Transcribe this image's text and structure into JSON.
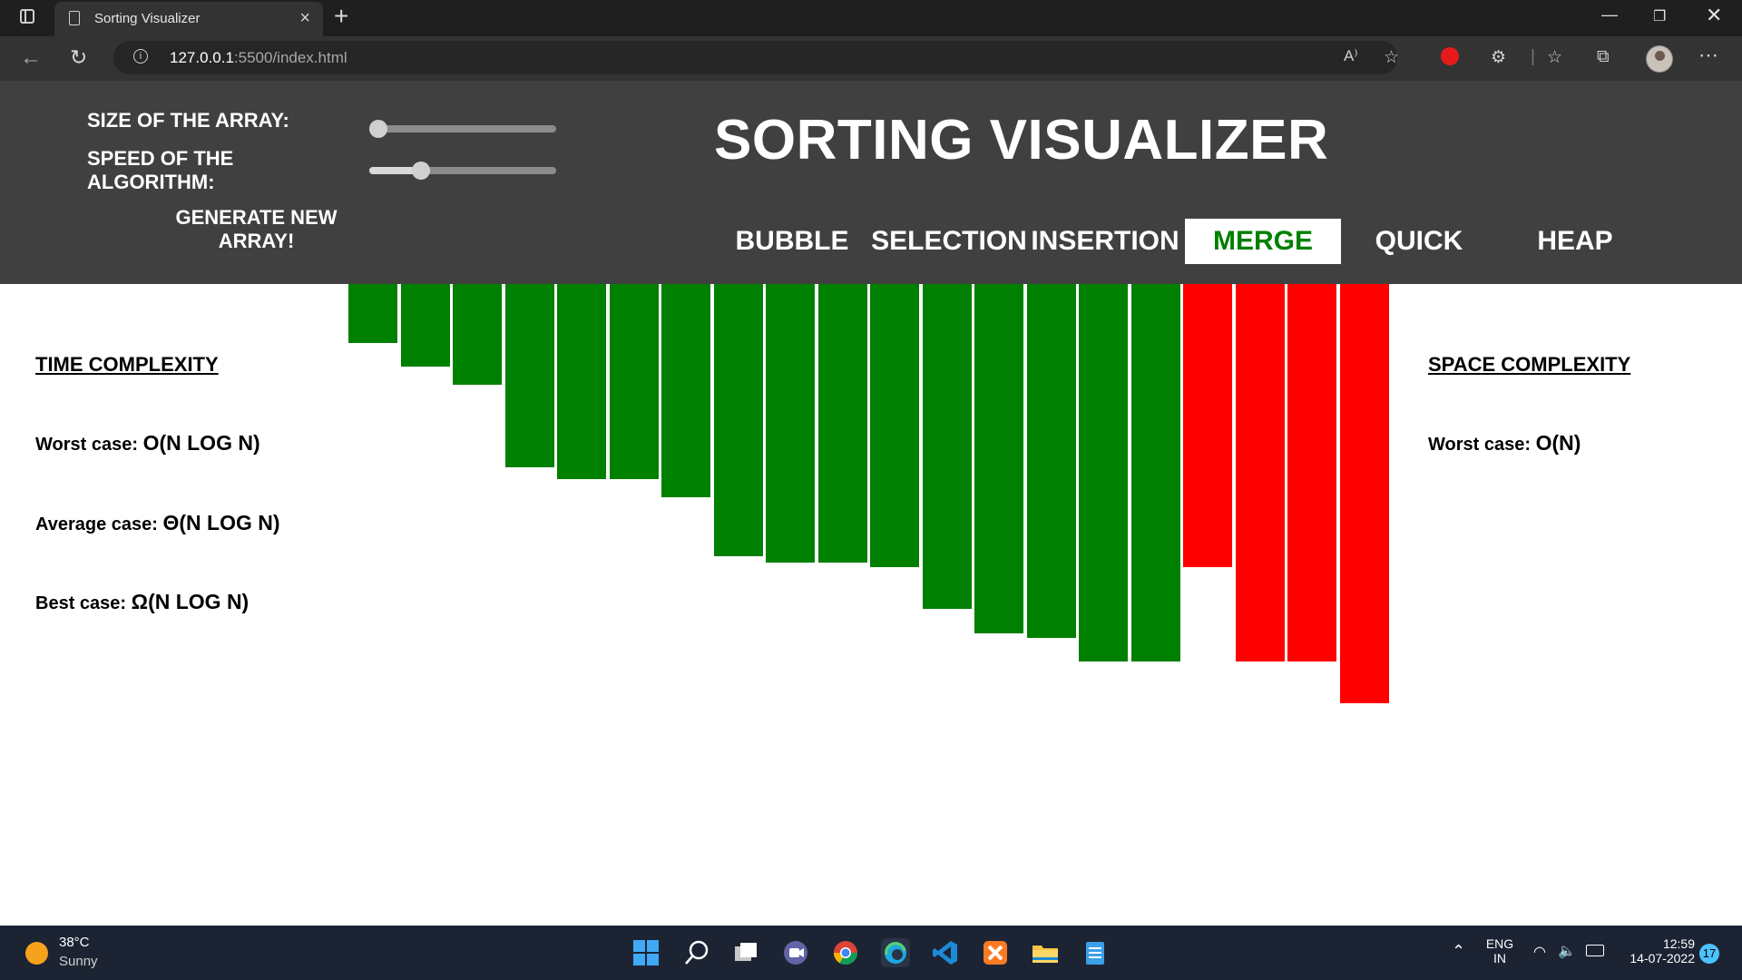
{
  "browser": {
    "tab_title": "Sorting Visualizer",
    "url_host": "127.0.0.1",
    "url_rest": ":5500/index.html"
  },
  "header": {
    "size_label": "SIZE OF THE ARRAY:",
    "speed_label_1": "SPEED OF THE",
    "speed_label_2": "ALGORITHM:",
    "size_value": 0.0,
    "speed_value": 0.25,
    "generate_1": "GENERATE NEW",
    "generate_2": "ARRAY!",
    "title": "SORTING VISUALIZER",
    "algorithms": [
      "BUBBLE",
      "SELECTION",
      "INSERTION",
      "MERGE",
      "QUICK",
      "HEAP"
    ],
    "active_algorithm": "MERGE"
  },
  "time_complexity": {
    "heading": "TIME COMPLEXITY",
    "worst_label": "Worst case:",
    "worst_value": "O(N LOG N)",
    "average_label": "Average case:",
    "average_value": "Θ(N LOG N)",
    "best_label": "Best case:",
    "best_value": "Ω(N LOG N)"
  },
  "space_complexity": {
    "heading": "SPACE COMPLEXITY",
    "worst_label": "Worst case:",
    "worst_value": "O(N)"
  },
  "array": {
    "values": [
      65,
      91,
      111,
      202,
      215,
      215,
      235,
      300,
      307,
      307,
      312,
      358,
      385,
      390,
      416,
      416,
      312,
      416,
      416,
      462
    ],
    "states": [
      "sorted",
      "sorted",
      "sorted",
      "sorted",
      "sorted",
      "sorted",
      "sorted",
      "sorted",
      "sorted",
      "sorted",
      "sorted",
      "sorted",
      "sorted",
      "sorted",
      "sorted",
      "sorted",
      "active",
      "active",
      "active",
      "active"
    ],
    "colors": {
      "sorted": "#008000",
      "active": "#ff0000"
    }
  },
  "taskbar": {
    "temperature": "38°C",
    "weather": "Sunny",
    "lang_1": "ENG",
    "lang_2": "IN",
    "time": "12:59",
    "date": "14-07-2022",
    "notifications": "17"
  }
}
